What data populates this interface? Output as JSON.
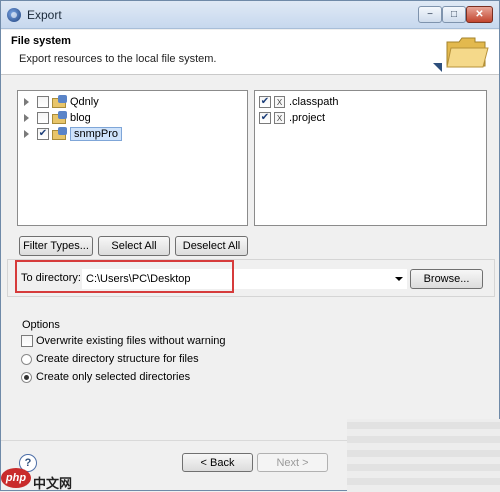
{
  "window": {
    "title": "Export"
  },
  "header": {
    "title": "File system",
    "description": "Export resources to the local file system."
  },
  "left_tree": {
    "items": [
      {
        "label": "Qdnly",
        "checked": false,
        "selected": false
      },
      {
        "label": "blog",
        "checked": false,
        "selected": false
      },
      {
        "label": "snmpPro",
        "checked": true,
        "selected": true
      }
    ]
  },
  "right_list": {
    "items": [
      {
        "label": ".classpath",
        "checked": true
      },
      {
        "label": ".project",
        "checked": true
      }
    ]
  },
  "buttons": {
    "filter_types": "Filter Types...",
    "select_all": "Select All",
    "deselect_all": "Deselect All",
    "browse": "Browse...",
    "back": "< Back",
    "next": "Next >"
  },
  "destination": {
    "label": "To directory:",
    "value": "C:\\Users\\PC\\Desktop"
  },
  "options": {
    "title": "Options",
    "overwrite": "Overwrite existing files without warning",
    "create_structure": "Create directory structure for files",
    "create_selected": "Create only selected directories"
  },
  "watermark": {
    "badge": "php",
    "text": "中文网"
  }
}
